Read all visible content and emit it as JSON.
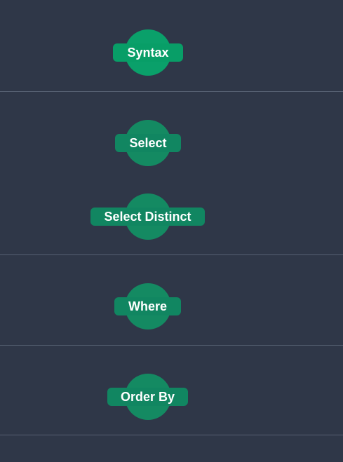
{
  "colors": {
    "background": "#2f3748",
    "divider": "#566072",
    "node_primary": "#0aa06a",
    "node": "#148a62",
    "text": "#ffffff"
  },
  "nodes": {
    "syntax": {
      "label": "Syntax"
    },
    "select": {
      "label": "Select"
    },
    "select_distinct": {
      "label": "Select Distinct"
    },
    "where": {
      "label": "Where"
    },
    "order_by": {
      "label": "Order By"
    }
  }
}
